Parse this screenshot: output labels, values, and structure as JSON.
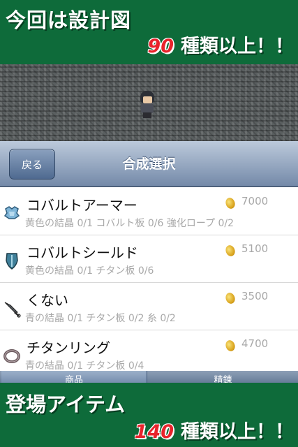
{
  "top_banner": {
    "title": "今回は設計図",
    "count": "90",
    "suffix": "種類以上！！"
  },
  "nav": {
    "back_label": "戻る",
    "title": "合成選択"
  },
  "items": [
    {
      "name": "コバルトアーマー",
      "materials": "黄色の結晶 0/1 コバルト板 0/6 強化ロープ 0/2",
      "price": "7000",
      "icon": "armor-icon"
    },
    {
      "name": "コバルトシールド",
      "materials": "黄色の結晶 0/1 チタン板 0/6",
      "price": "5100",
      "icon": "shield-icon"
    },
    {
      "name": "くない",
      "materials": "青の結晶 0/1 チタン板 0/2 糸 0/2",
      "price": "3500",
      "icon": "kunai-icon"
    },
    {
      "name": "チタンリング",
      "materials": "青の結晶 0/1 チタン板 0/4",
      "price": "4700",
      "icon": "ring-icon"
    }
  ],
  "tabs": {
    "left": "商品",
    "right": "精錬"
  },
  "bottom_banner": {
    "title": "登場アイテム",
    "count": "140",
    "suffix": "種類以上！！"
  },
  "colors": {
    "banner_green": "#0e6b3a",
    "count_red": "#e8242c",
    "nav_blue": "#7389a8"
  }
}
